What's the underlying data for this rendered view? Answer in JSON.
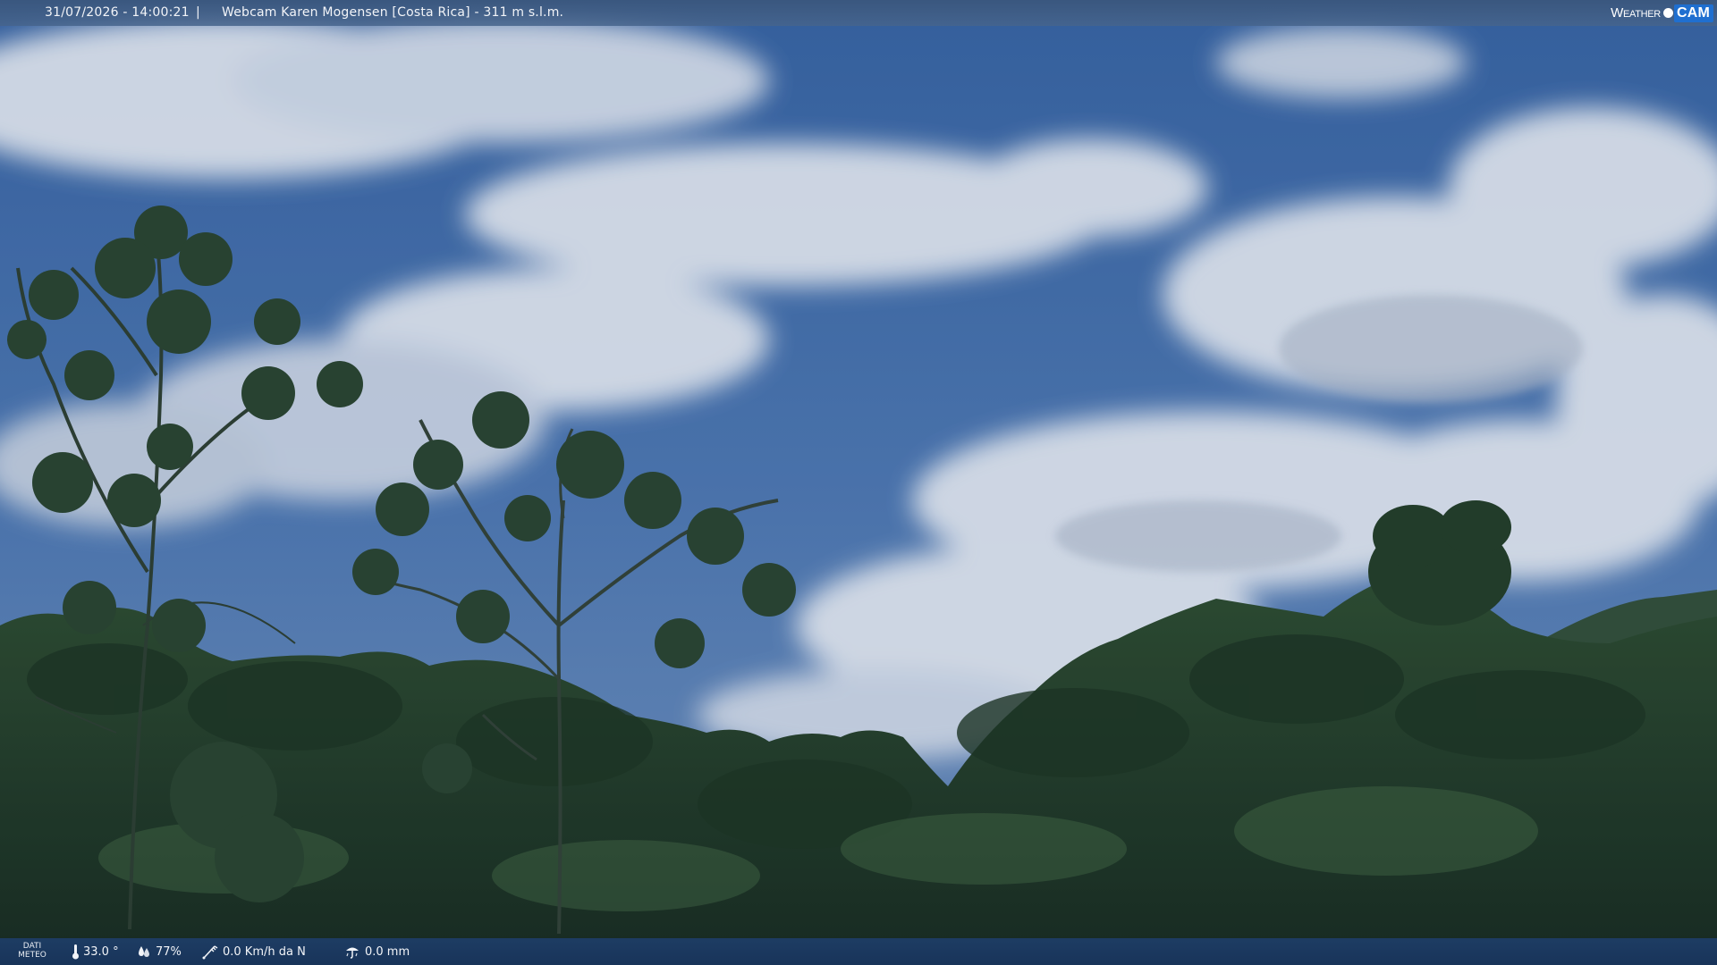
{
  "header": {
    "timestamp": "31/07/2026 - 14:00:21",
    "separator": "|",
    "title": "Webcam Karen Mogensen [Costa Rica]  - 311 m s.l.m."
  },
  "brand": {
    "weather": "Weather",
    "cam": "CAM"
  },
  "footer": {
    "dati_line1": "DATI",
    "dati_line2": "METEO",
    "temperature": "33.0 °",
    "humidity": "77%",
    "wind": "0.0 Km/h da N",
    "rain": "0.0 mm"
  },
  "icons": {
    "temperature": "thermometer-icon",
    "humidity": "drops-icon",
    "wind": "wind-icon",
    "rain": "rain-gauge-icon"
  },
  "colors": {
    "sky": "#3f6aa6",
    "cloud": "#e6ebf1",
    "forest": "#1d3a1f",
    "brand_blue": "#1f6fd0"
  }
}
